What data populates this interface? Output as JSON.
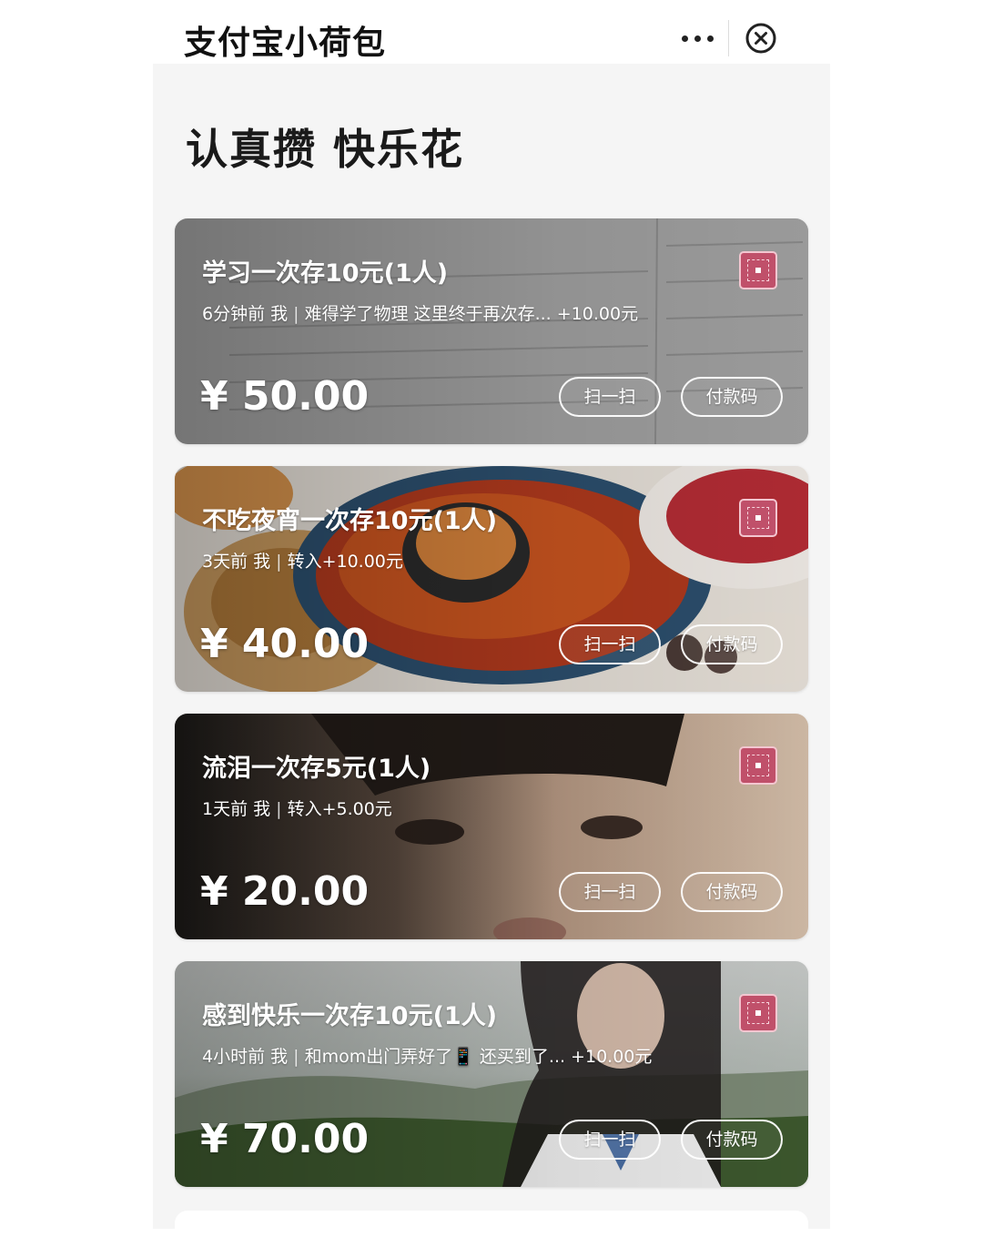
{
  "header": {
    "title": "支付宝小荷包",
    "more_icon": "more-dots-icon",
    "close_icon": "close-circle-icon"
  },
  "headline": "认真攒 快乐花",
  "cards": [
    {
      "title": "学习一次存10元(1人)",
      "time": "6分钟前",
      "who": "我",
      "note": "难得学了物理 这里终于再次存... +10.00元",
      "amount": "¥ 50.00",
      "scan_label": "扫一扫",
      "pay_label": "付款码",
      "theme": "#8a8a8a"
    },
    {
      "title": "不吃夜宵一次存10元(1人)",
      "time": "3天前",
      "who": "我",
      "note": "转入+10.00元",
      "amount": "¥ 40.00",
      "scan_label": "扫一扫",
      "pay_label": "付款码",
      "theme": "#b5542c"
    },
    {
      "title": "流泪一次存5元(1人)",
      "time": "1天前",
      "who": "我",
      "note": "转入+5.00元",
      "amount": "¥ 20.00",
      "scan_label": "扫一扫",
      "pay_label": "付款码",
      "theme": "#3a3430"
    },
    {
      "title": "感到快乐一次存10元(1人)",
      "time": "4小时前",
      "who": "我",
      "note": "和mom出门弄好了📱 还买到了... +10.00元",
      "amount": "¥ 70.00",
      "scan_label": "扫一扫",
      "pay_label": "付款码",
      "theme": "#7d8a7a"
    }
  ]
}
